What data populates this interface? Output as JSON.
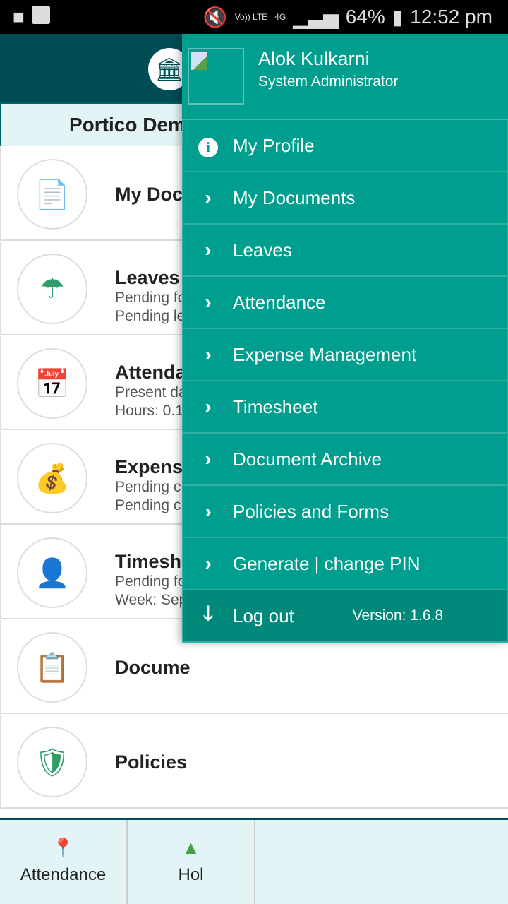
{
  "status_bar": {
    "battery": "64%",
    "time": "12:52 pm",
    "network": "4G",
    "volte": "Vo)) LTE"
  },
  "background": {
    "page_title": "Portico Dem",
    "cards": [
      {
        "title": "My Docu",
        "lines": [],
        "icon": "documents-icon"
      },
      {
        "title": "Leaves",
        "lines": [
          "Pending fo",
          "Pending le"
        ],
        "icon": "umbrella-icon"
      },
      {
        "title": "Attenda",
        "lines": [
          "Present da",
          "Hours: 0.1"
        ],
        "icon": "calendar-clock-icon"
      },
      {
        "title": "Expense",
        "lines": [
          "Pending c",
          "Pending c"
        ],
        "icon": "expense-bag-icon"
      },
      {
        "title": "Timeshe",
        "lines": [
          "Pending fo",
          "Week: Sep"
        ],
        "icon": "user-calendar-icon"
      },
      {
        "title": "Docume",
        "lines": [],
        "icon": "archive-icon"
      },
      {
        "title": "Policies",
        "lines": [],
        "icon": "policy-shield-icon"
      }
    ],
    "bottom_nav": [
      {
        "label": "Attendance",
        "icon": "location-pin-icon"
      },
      {
        "label": "Hol",
        "icon": "tree-icon"
      }
    ]
  },
  "drawer": {
    "user_name": "Alok Kulkarni",
    "user_role": "System Administrator",
    "items": [
      {
        "label": "My Profile",
        "icon": "info-icon"
      },
      {
        "label": "My Documents",
        "icon": "chevron-right-icon"
      },
      {
        "label": "Leaves",
        "icon": "chevron-right-icon"
      },
      {
        "label": "Attendance",
        "icon": "chevron-right-icon"
      },
      {
        "label": "Expense Management",
        "icon": "chevron-right-icon"
      },
      {
        "label": "Timesheet",
        "icon": "chevron-right-icon"
      },
      {
        "label": "Document Archive",
        "icon": "chevron-right-icon"
      },
      {
        "label": "Policies and Forms",
        "icon": "chevron-right-icon"
      },
      {
        "label": "Generate | change PIN",
        "icon": "chevron-right-icon"
      }
    ],
    "logout_label": "Log out",
    "version": "Version: 1.6.8"
  },
  "colors": {
    "drawer": "#009e8f",
    "appbar": "#004d56",
    "logout": "#00897b"
  }
}
